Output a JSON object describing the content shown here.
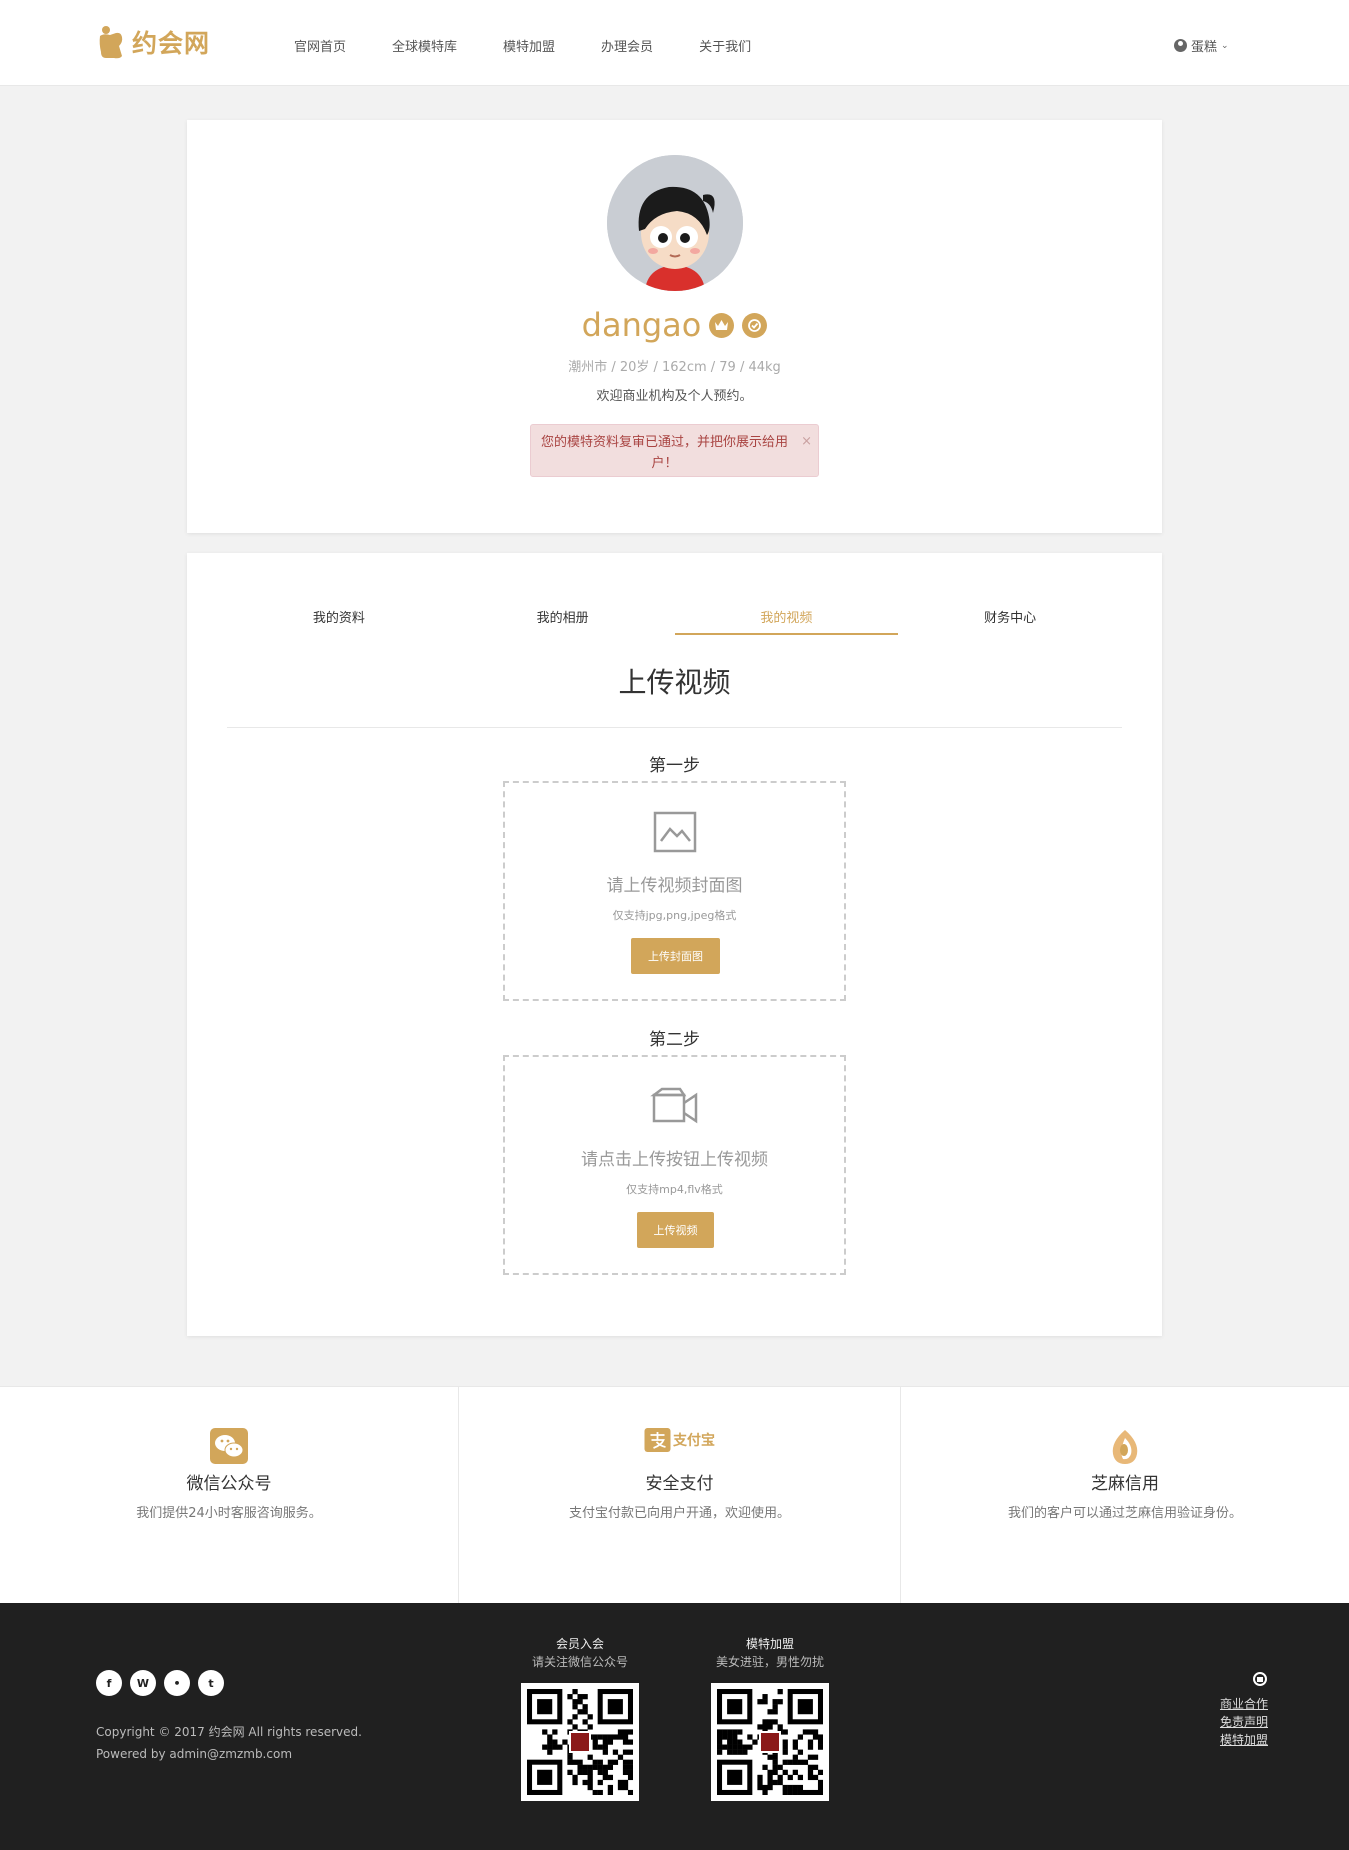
{
  "header": {
    "logo_text": "约会网",
    "nav": [
      "官网首页",
      "全球模特库",
      "模特加盟",
      "办理会员",
      "关于我们"
    ],
    "user_name": "蛋糕",
    "user_icon": "user-circle-icon",
    "chevron_icon": "chevron-down-icon"
  },
  "profile": {
    "username": "dangao",
    "badges": [
      "crown-icon",
      "verified-icon"
    ],
    "meta": "潮州市 / 20岁 / 162cm / 79 / 44kg",
    "bio": "欢迎商业机构及个人预约。",
    "alert": "您的模特资料复审已通过，并把你展示给用户！",
    "alert_close": "×"
  },
  "tabs": {
    "items": [
      "我的资料",
      "我的相册",
      "我的视频",
      "财务中心"
    ],
    "active": "我的视频"
  },
  "upload": {
    "title": "上传视频",
    "step1": {
      "label": "第一步",
      "icon": "image-icon",
      "title": "请上传视频封面图",
      "hint": "仅支持jpg,png,jpeg格式",
      "button": "上传封面图"
    },
    "step2": {
      "label": "第二步",
      "icon": "video-camera-icon",
      "title": "请点击上传按钮上传视频",
      "hint": "仅支持mp4,flv格式",
      "button": "上传视频"
    }
  },
  "features": [
    {
      "icon": "wechat-icon",
      "title": "微信公众号",
      "desc": "我们提供24小时客服咨询服务。"
    },
    {
      "icon": "alipay-icon",
      "title": "安全支付",
      "desc": "支付宝付款已向用户开通，欢迎使用。",
      "logo_text": "支付宝"
    },
    {
      "icon": "sesame-credit-icon",
      "title": "芝麻信用",
      "desc": "我们的客户可以通过芝麻信用验证身份。"
    }
  ],
  "footer": {
    "socials": [
      "facebook-icon",
      "weibo-icon",
      "wechat-icon",
      "twitter-icon"
    ],
    "social_glyphs": [
      "f",
      "W",
      "•",
      "t"
    ],
    "copyright": "Copyright © 2017 约会网 All rights reserved.",
    "powered": "Powered by admin@zmzmb.com",
    "qr1": {
      "title": "会员入会",
      "sub": "请关注微信公众号"
    },
    "qr2": {
      "title": "模特加盟",
      "sub": "美女进驻，男性勿扰"
    },
    "links": [
      "商业合作",
      "免责声明",
      "模特加盟"
    ],
    "service_icon": "customer-service-icon"
  },
  "colors": {
    "accent": "#d2a65a",
    "alert_bg": "#f2dede",
    "alert_text": "#a94442",
    "footer_bg": "#202020"
  }
}
